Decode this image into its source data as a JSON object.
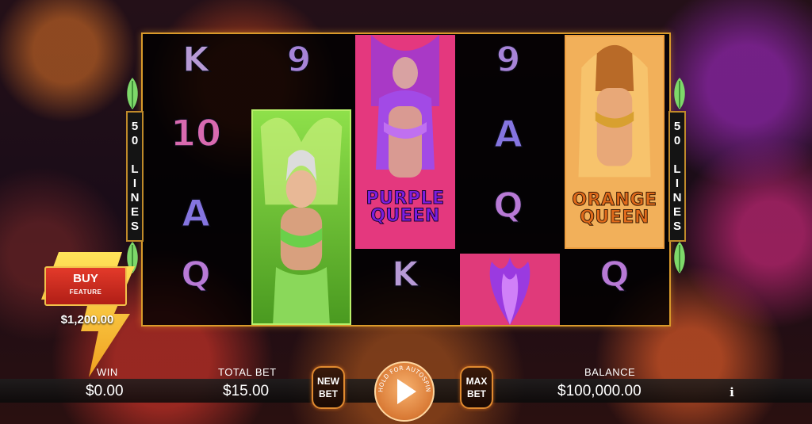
{
  "lines_badge": {
    "left_text": "50 LINES",
    "right_text": "50 LINES"
  },
  "reels": {
    "symbols": [
      {
        "text": "K",
        "kind": "k"
      },
      {
        "text": "10",
        "kind": "10"
      },
      {
        "text": "A",
        "kind": "a"
      },
      {
        "text": "Q",
        "kind": "q"
      },
      {
        "text": "9",
        "kind": "9"
      },
      {
        "text": "K",
        "kind": "k"
      },
      {
        "text": "9",
        "kind": "9"
      },
      {
        "text": "A",
        "kind": "a"
      },
      {
        "text": "Q",
        "kind": "q"
      },
      {
        "text": "Q",
        "kind": "q"
      }
    ],
    "cards": [
      {
        "name": "green-queen",
        "title": ""
      },
      {
        "name": "purple-queen",
        "title": "PURPLE\nQUEEN",
        "color": "#7a1ee0"
      },
      {
        "name": "orange-queen",
        "title": "ORANGE\nQUEEN",
        "color": "#e06a1a"
      },
      {
        "name": "purple-feather",
        "title": ""
      }
    ]
  },
  "buy_feature": {
    "label": "BUY",
    "sub": "FEATURE",
    "price": "$1,200.00"
  },
  "stats": {
    "win_label": "WIN",
    "win_value": "$0.00",
    "total_bet_label": "TOTAL BET",
    "total_bet_value": "$15.00",
    "balance_label": "BALANCE",
    "balance_value": "$100,000.00"
  },
  "controls": {
    "new_bet": "NEW\nBET",
    "max_bet": "MAX\nBET",
    "spin_ring_text": "HOLD FOR AUTOSPIN",
    "info": "i"
  },
  "colors": {
    "frame": "#d99a2b",
    "spin": "#d97a35",
    "buy": "#e33a2a",
    "accent_purple": "#7a1ee0",
    "accent_orange": "#e06a1a"
  }
}
